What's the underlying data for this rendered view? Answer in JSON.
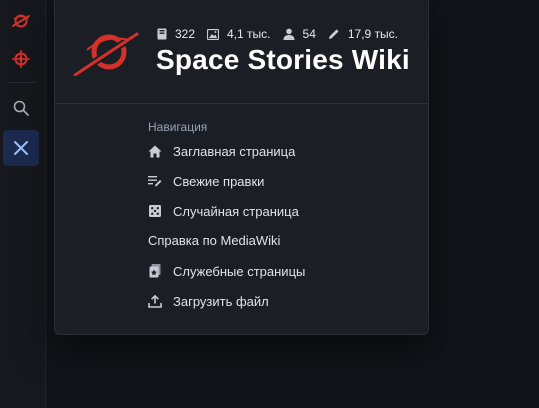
{
  "site": {
    "name": "Space Stories Wiki",
    "logo_icon": "space-stories-logo",
    "accent_color": "#d5312b"
  },
  "stats": [
    {
      "icon": "book-icon",
      "value": "322"
    },
    {
      "icon": "image-icon",
      "value": "4,1 тыс."
    },
    {
      "icon": "user-icon",
      "value": "54"
    },
    {
      "icon": "pencil-icon",
      "value": "17,9 тыс."
    }
  ],
  "nav": {
    "heading": "Навигация",
    "items": [
      {
        "icon": "home-icon",
        "label": "Заглавная страница"
      },
      {
        "icon": "recent-changes-icon",
        "label": "Свежие правки"
      },
      {
        "icon": "dice-icon",
        "label": "Случайная страница"
      }
    ],
    "help_link": "Справка по MediaWiki",
    "tools": [
      {
        "icon": "special-pages-icon",
        "label": "Служебные страницы"
      },
      {
        "icon": "upload-icon",
        "label": "Загрузить файл"
      }
    ]
  },
  "sidebar": {
    "buttons": [
      {
        "icon": "site-logo-icon"
      },
      {
        "icon": "compass-icon"
      },
      {
        "icon": "search-icon"
      },
      {
        "icon": "close-icon"
      }
    ]
  }
}
